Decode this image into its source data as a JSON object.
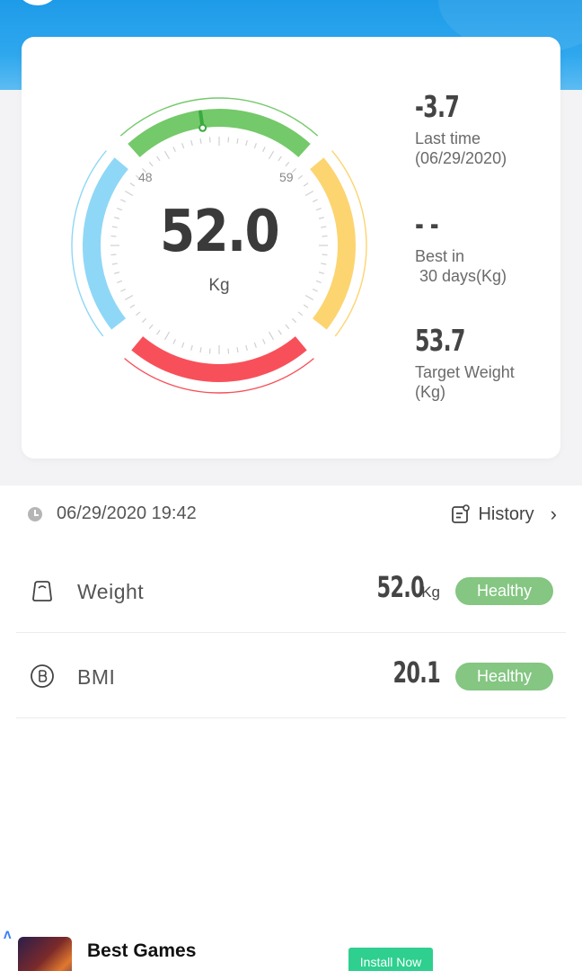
{
  "gauge": {
    "value": "52.0",
    "unit": "Kg",
    "tick_left": "48",
    "tick_right": "59",
    "colors": {
      "underweight": "#8fd7f6",
      "normal": "#74c96a",
      "overweight": "#fcd571",
      "obese": "#f8505a"
    }
  },
  "stats": {
    "last_change_value": "-3.7",
    "last_change_label": "Last time\n(06/29/2020)",
    "best_value": "- -",
    "best_label": "Best in\n 30 days(Kg)",
    "target_value": "53.7",
    "target_label": "Target Weight\n(Kg)"
  },
  "record": {
    "datetime": "06/29/2020 19:42",
    "history_label": "History"
  },
  "metrics": {
    "weight": {
      "name": "Weight",
      "value": "52.0",
      "unit": "Kg",
      "status": "Healthy"
    },
    "bmi": {
      "name": "BMI",
      "value": "20.1",
      "status": "Healthy"
    }
  },
  "ad": {
    "marker": "ᐱ",
    "title": "Best Games",
    "button": "Install Now"
  },
  "theme": {
    "header_blue": "#1e9be8",
    "badge_green": "#84c682",
    "install_green": "#2ecf8f"
  }
}
